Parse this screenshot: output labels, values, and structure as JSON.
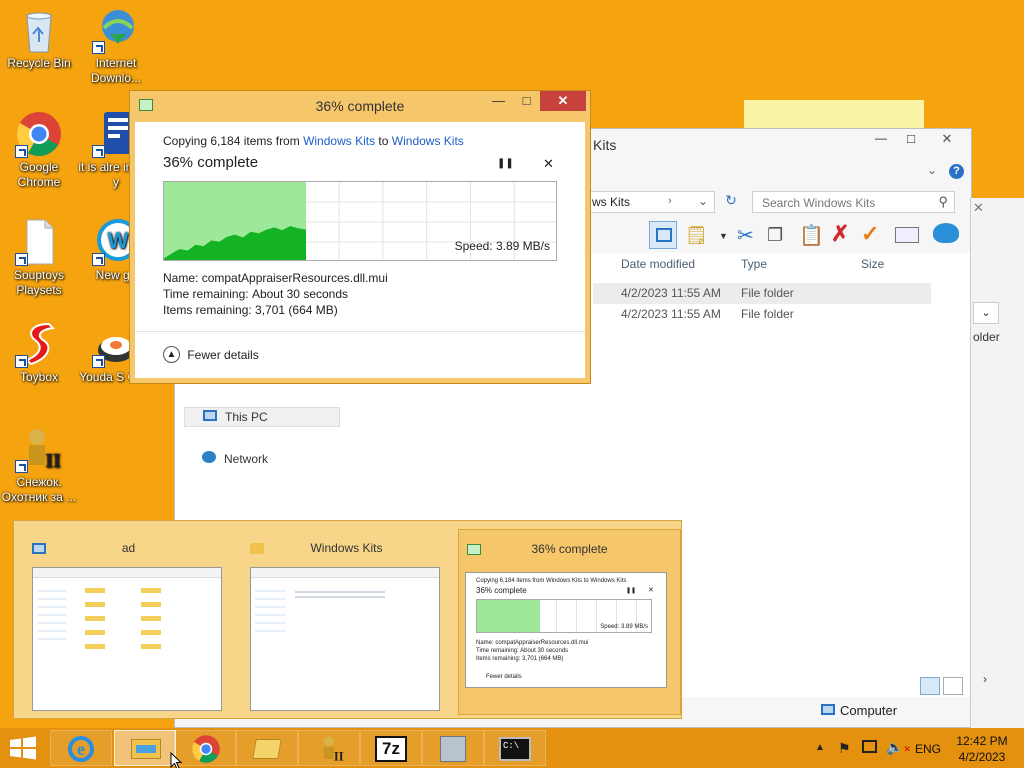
{
  "desktop": {
    "icons": [
      {
        "label": "Recycle Bin"
      },
      {
        "label": "Internet Downlo..."
      },
      {
        "label": "Google Chrome"
      },
      {
        "label": "it is alre install y"
      },
      {
        "label": "Souptoys Playsets"
      },
      {
        "label": "New ga"
      },
      {
        "label": "Toybox"
      },
      {
        "label": "Youda S Chef"
      },
      {
        "label": "Снежок. Охотник за ..."
      }
    ]
  },
  "copy_dialog": {
    "title": "36% complete",
    "copying_prefix": "Copying 6,184 items from ",
    "source": "Windows Kits",
    "to_word": " to ",
    "destination": "Windows Kits",
    "percent_text": "36% complete",
    "progress_percent": 36,
    "speed_label": "Speed: 3.89 MB/s",
    "name_label": "Name:",
    "name_value": "compatAppraiserResources.dll.mui",
    "time_label": "Time remaining:",
    "time_value": "About 30 seconds",
    "items_label": "Items remaining:",
    "items_value": "3,701 (664 MB)",
    "fewer_details": "Fewer details",
    "pause_glyph": "❚❚",
    "close_glyph": "✕"
  },
  "explorer": {
    "title_partial": "Kits",
    "address_partial": "ws Kits",
    "search_placeholder": "Search Windows Kits",
    "columns": [
      "Date modified",
      "Type",
      "Size"
    ],
    "rows": [
      {
        "date": "4/2/2023 11:55 AM",
        "type": "File folder"
      },
      {
        "date": "4/2/2023 11:55 AM",
        "type": "File folder"
      }
    ],
    "nav_this_pc": "This PC",
    "nav_network": "Network",
    "status_computer": "Computer",
    "behind_text": "older"
  },
  "switcher": {
    "items": [
      {
        "title": "ad"
      },
      {
        "title": "Windows Kits"
      },
      {
        "title": "36% complete"
      }
    ],
    "mini": {
      "copying": "Copying 6,184 items from Windows Kits to Windows Kits",
      "percent": "36% complete",
      "speed": "Speed: 3.89 MB/s",
      "name": "Name: compatAppraiserResources.dll.mui",
      "time": "Time remaining: About 30 seconds",
      "items": "Items remaining: 3,701 (664 MB)",
      "fewer": "Fewer details"
    }
  },
  "taskbar": {
    "tray_language": "ENG",
    "clock_time": "12:42 PM",
    "clock_date": "4/2/2023",
    "sevenzip_label": "7z"
  },
  "colors": {
    "desktop": "#f5a30f",
    "progress_green": "#13b324",
    "progress_fill": "#9ee89a",
    "close_red": "#c7423c",
    "link_blue": "#1c5ec8"
  }
}
